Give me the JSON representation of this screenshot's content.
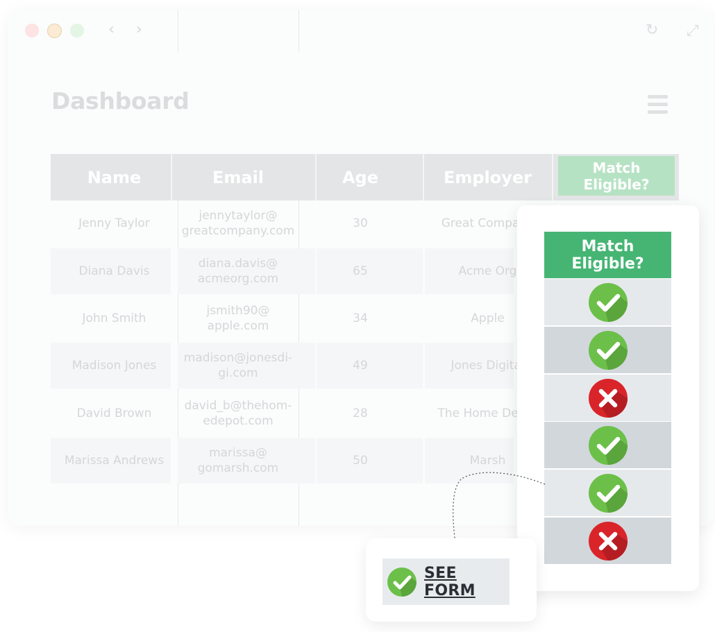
{
  "browser": {
    "back_icon": "chevron-left-icon",
    "forward_icon": "chevron-right-icon",
    "refresh_icon": "refresh-icon",
    "expand_icon": "expand-icon"
  },
  "page": {
    "title": "Dashboard",
    "menu_icon": "hamburger-icon"
  },
  "table": {
    "headers": {
      "name": "Name",
      "email": "Email",
      "age": "Age",
      "employer": "Employer",
      "match": "Match Eligible?"
    },
    "rows": [
      {
        "name": "Jenny Taylor",
        "email": "jennytaylor@ greatcompany.com",
        "age": "30",
        "employer": "Great Company",
        "eligible": true
      },
      {
        "name": "Diana Davis",
        "email": "diana.davis@ acmeorg.com",
        "age": "65",
        "employer": "Acme Org",
        "eligible": true
      },
      {
        "name": "John Smith",
        "email": "jsmith90@ apple.com",
        "age": "34",
        "employer": "Apple",
        "eligible": false
      },
      {
        "name": "Madison Jones",
        "email": "madison@jonesdi-gi.com",
        "age": "49",
        "employer": "Jones Digital",
        "eligible": true
      },
      {
        "name": "David Brown",
        "email": "david_b@thehom-edepot.com",
        "age": "28",
        "employer": "The Home Depot",
        "eligible": true
      },
      {
        "name": "Marissa Andrews",
        "email": "marissa@ gomarsh.com",
        "age": "50",
        "employer": "Marsh",
        "eligible": false
      }
    ]
  },
  "match_panel": {
    "header": "Match Eligible?",
    "check_icon": "check-circle-icon",
    "cross_icon": "x-circle-icon"
  },
  "form_action": {
    "label": "SEE FORM",
    "icon": "check-circle-icon"
  },
  "colors": {
    "accent_green": "#46b574",
    "check_green": "#6cc04a",
    "cross_red": "#d9252a"
  }
}
